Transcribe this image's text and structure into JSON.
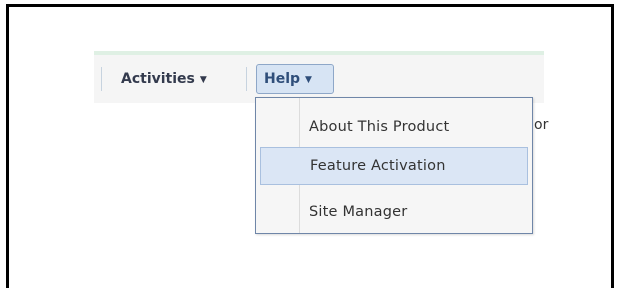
{
  "toolbar": {
    "activities_label": "Activities",
    "help_label": "Help",
    "caret_glyph": "▼"
  },
  "help_menu": {
    "items": [
      {
        "label": "About This Product"
      },
      {
        "label": "Feature Activation",
        "highlighted": true
      },
      {
        "label": "Site Manager"
      }
    ]
  },
  "background_fragment": "or",
  "colors": {
    "highlight": "#dbe6f5",
    "help_active": "#d7e4f4",
    "menu_border": "#6f86a8"
  }
}
